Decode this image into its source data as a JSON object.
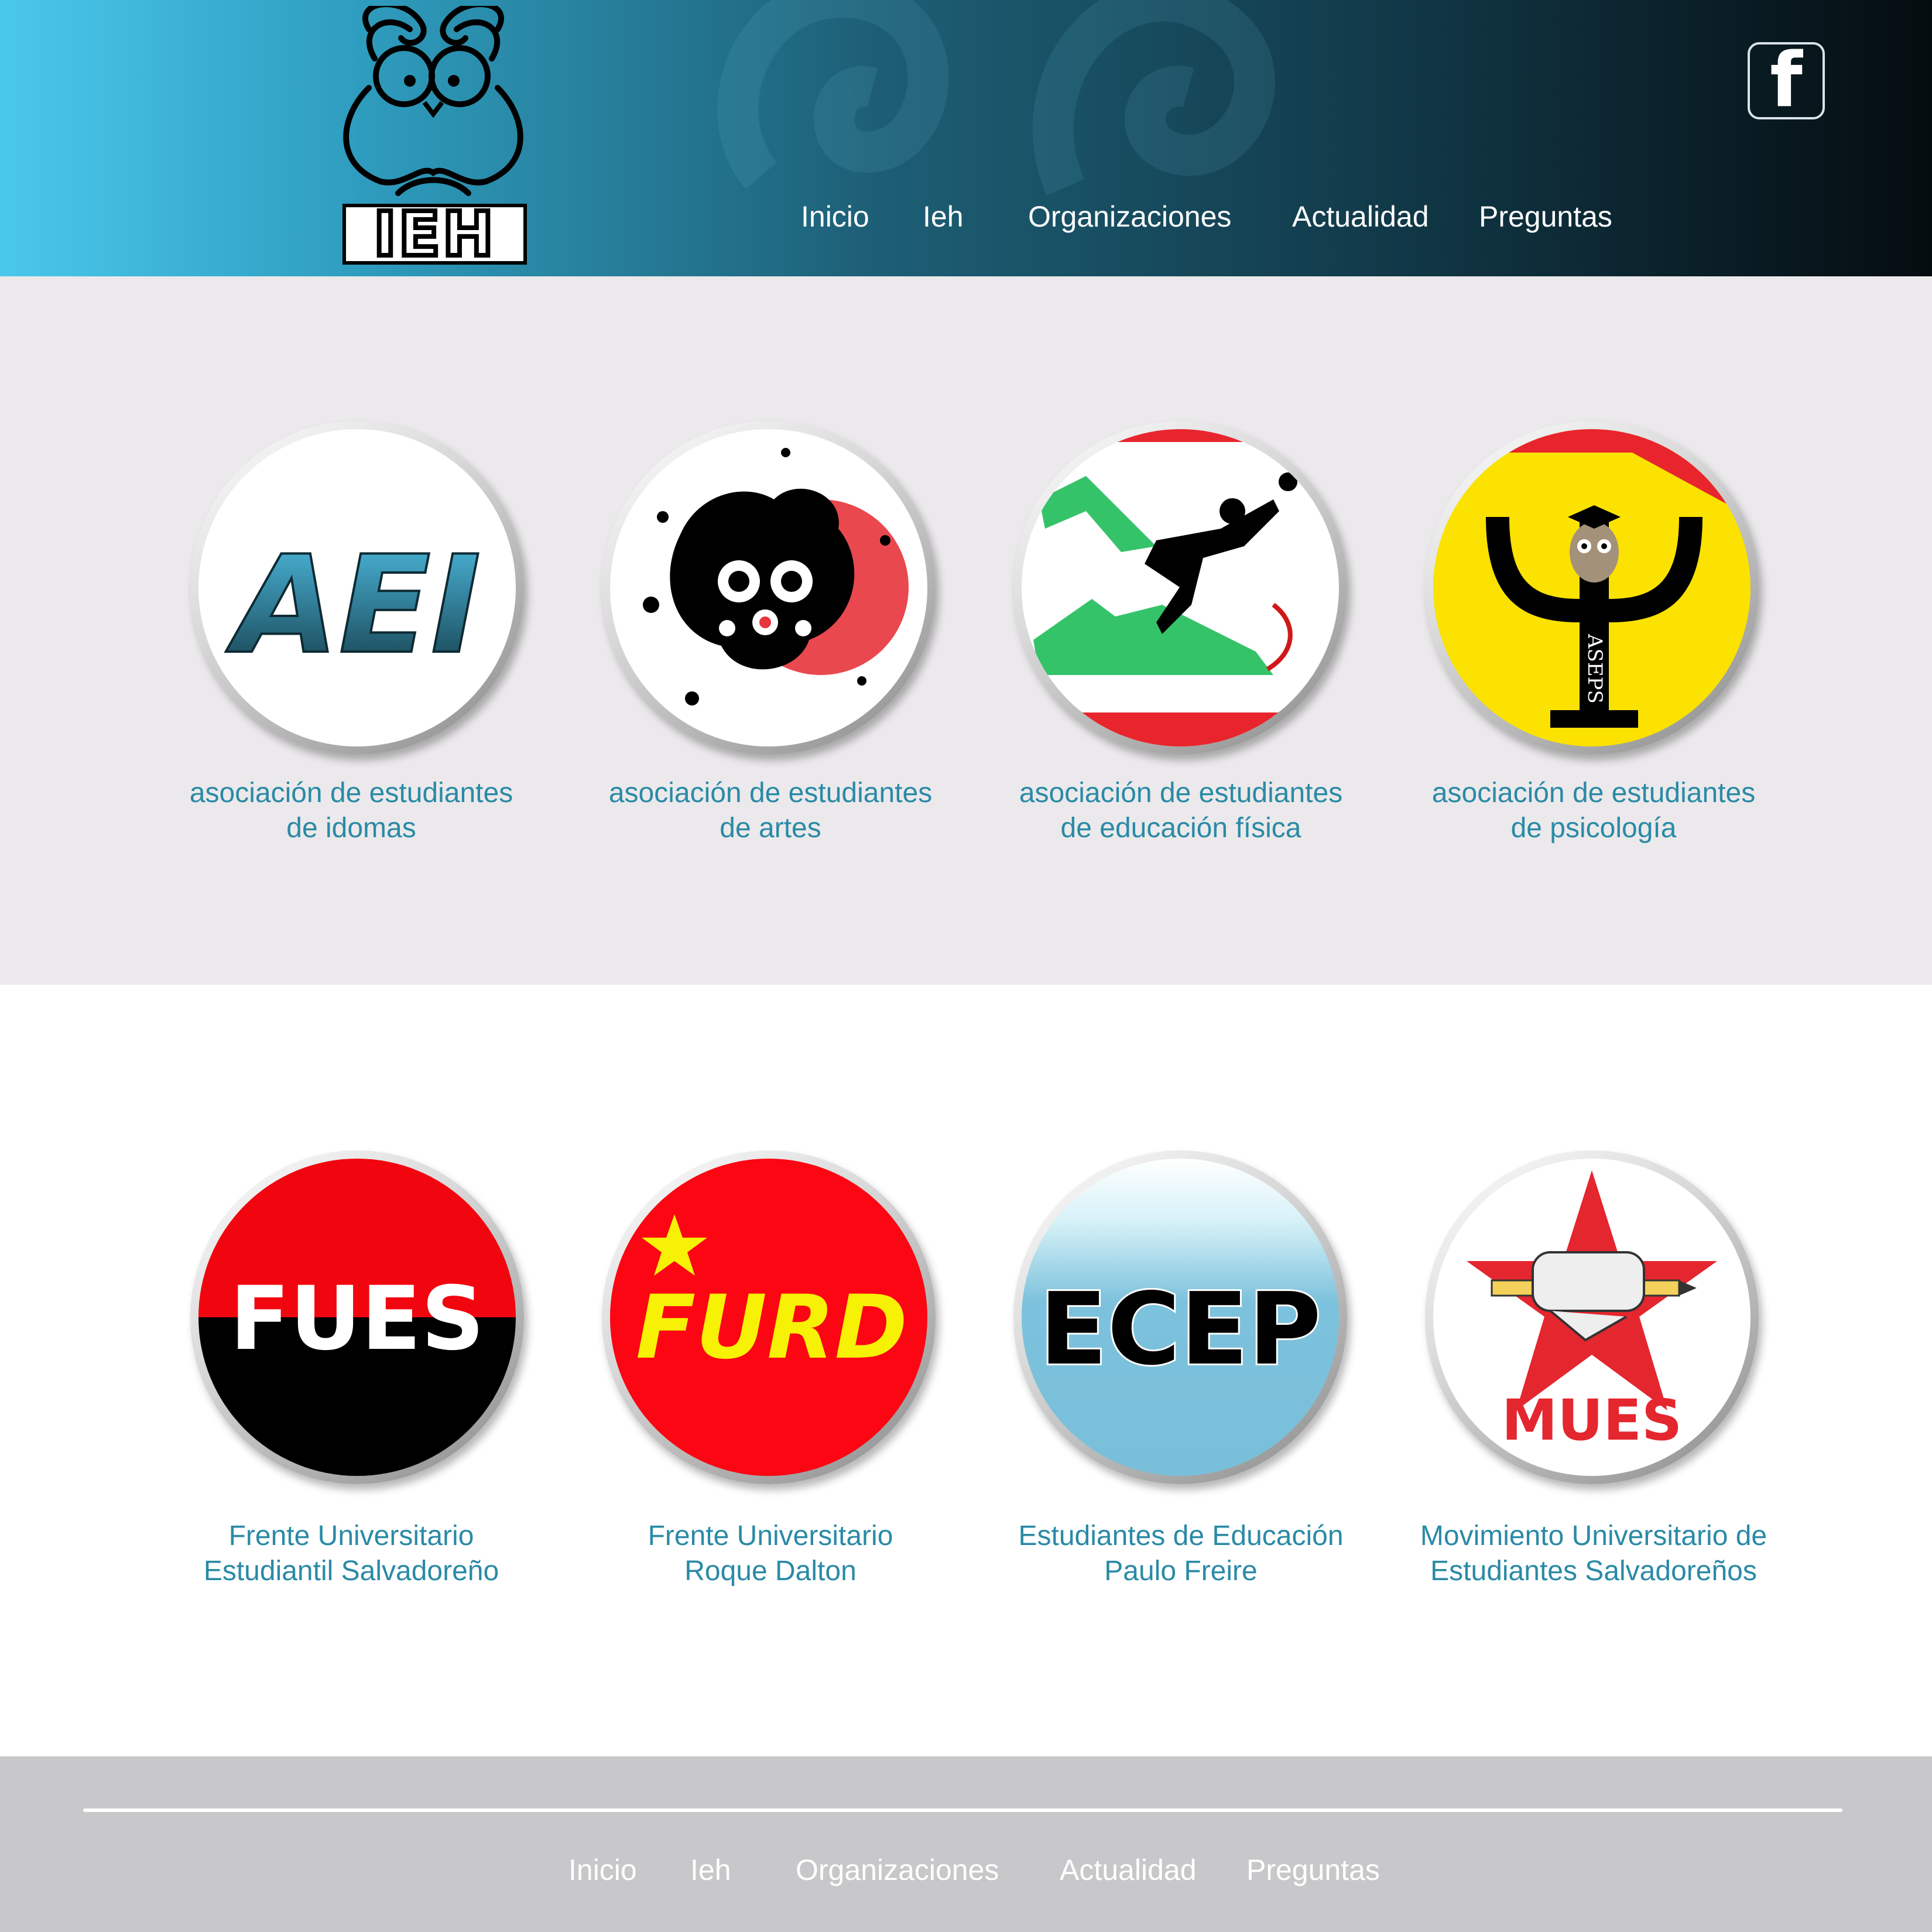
{
  "header": {
    "logo_text": "IEH",
    "facebook_icon": "facebook-icon",
    "nav": [
      "Inicio",
      "Ieh",
      "Organizaciones",
      "Actualidad",
      "Preguntas"
    ]
  },
  "associations": [
    {
      "badge_text": "AEI",
      "caption_line1": "asociación de estudiantes",
      "caption_line2": "de idomas"
    },
    {
      "badge_text": "",
      "caption_line1": "asociación de estudiantes",
      "caption_line2": "de artes"
    },
    {
      "badge_text": "",
      "caption_line1": "asociación de estudiantes",
      "caption_line2": "de educación física"
    },
    {
      "badge_text": "ASEPS",
      "caption_line1": "asociación de estudiantes",
      "caption_line2": "de psicología"
    }
  ],
  "fronts": [
    {
      "badge_text": "FUES",
      "caption_line1": "Frente Universitario",
      "caption_line2": "Estudiantil Salvadoreño"
    },
    {
      "badge_text": "FURD",
      "caption_line1": "Frente Universitario",
      "caption_line2": "Roque Dalton"
    },
    {
      "badge_text": "ECEP",
      "caption_line1": "Estudiantes de Educación",
      "caption_line2": "Paulo Freire"
    },
    {
      "badge_text": "MUES",
      "caption_line1": "Movimiento Universitario de",
      "caption_line2": "Estudiantes Salvadoreños"
    }
  ],
  "footer": {
    "nav": [
      "Inicio",
      "Ieh",
      "Organizaciones",
      "Actualidad",
      "Preguntas"
    ]
  },
  "colors": {
    "caption": "#2a8aa6",
    "header_start": "#4ac8ec",
    "header_end": "#050c10",
    "band": "#ebe9eb",
    "footer": "#c8c7c9"
  }
}
